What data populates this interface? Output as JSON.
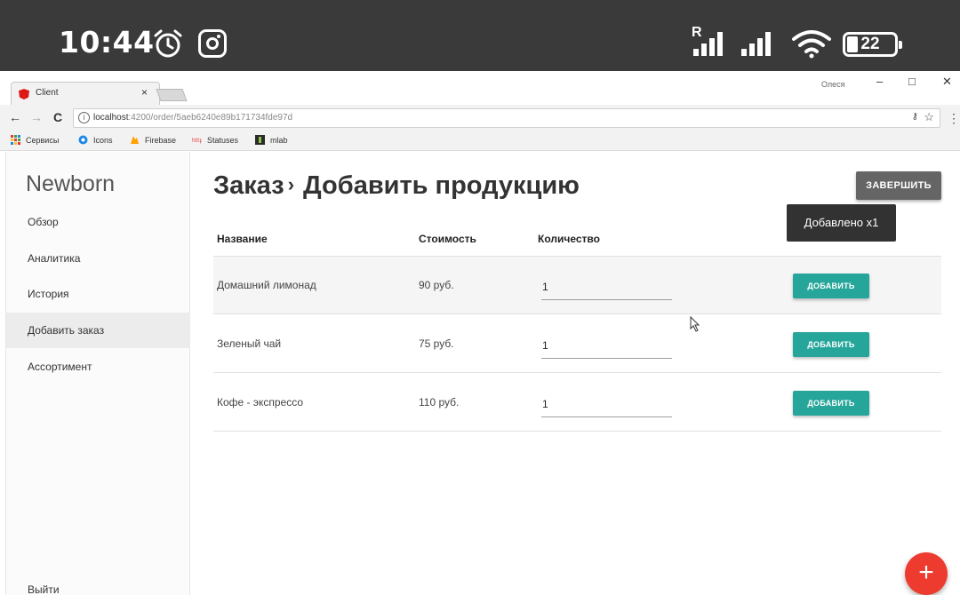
{
  "status_bar": {
    "time": "10:44",
    "roaming_label": "R",
    "battery_level": "22",
    "icons": [
      "alarm-icon",
      "instagram-icon",
      "signal-icon",
      "signal-icon",
      "wifi-icon",
      "battery-icon"
    ]
  },
  "browser": {
    "tab_title": "Client",
    "tab_close": "×",
    "window_user": "Олеся",
    "window_controls": {
      "minimize": "–",
      "maximize": "□",
      "close": "✕"
    },
    "nav": {
      "back": "←",
      "forward": "→",
      "reload": "C"
    },
    "url_host": "localhost",
    "url_path": ":4200/order/5aeb6240e89b171734fde97d",
    "bookmarks": [
      "Сервисы",
      "Icons",
      "Firebase",
      "Statuses",
      "mlab"
    ],
    "accent_colors": {
      "angular": "#dd1b16",
      "icons": "#1e88e5",
      "firebase": "#ffa000"
    }
  },
  "sidebar": {
    "brand": "Newborn",
    "items": [
      {
        "label": "Обзор",
        "active": false
      },
      {
        "label": "Аналитика",
        "active": false
      },
      {
        "label": "История",
        "active": false
      },
      {
        "label": "Добавить заказ",
        "active": true
      },
      {
        "label": "Ассортимент",
        "active": false
      }
    ],
    "logout": "Выйти"
  },
  "page": {
    "breadcrumb": "Заказ",
    "breadcrumb_sep": "›",
    "title": "Добавить продукцию",
    "finish_button": "ЗАВЕРШИТЬ",
    "toast": "Добавлено x1"
  },
  "table": {
    "headers": {
      "name": "Название",
      "cost": "Стоимость",
      "quantity": "Количество"
    },
    "rows": [
      {
        "name": "Домашний лимонад",
        "cost": "90 руб.",
        "quantity": "1",
        "button": "ДОБАВИТЬ"
      },
      {
        "name": "Зеленый чай",
        "cost": "75 руб.",
        "quantity": "1",
        "button": "ДОБАВИТЬ"
      },
      {
        "name": "Кофе - экспрессо",
        "cost": "110 руб.",
        "quantity": "1",
        "button": "ДОБАВИТЬ"
      }
    ]
  },
  "fab": {
    "label": "+"
  },
  "colors": {
    "teal": "#26a69a",
    "fab_red": "#ee3b2f",
    "finish_gray": "#656565",
    "toast": "#323232",
    "status_bar": "#3a3a3a"
  }
}
